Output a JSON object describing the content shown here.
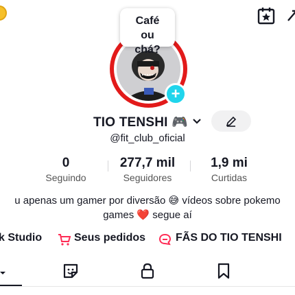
{
  "profile": {
    "bubble_text": "Café ou chá?",
    "username": "TIO TENSHI 🎮",
    "handle": "@fit_club_oficial"
  },
  "stats": [
    {
      "value": "0",
      "label": "Seguindo"
    },
    {
      "value": "277,7 mil",
      "label": "Seguidores"
    },
    {
      "value": "1,9 mi",
      "label": "Curtidas"
    }
  ],
  "bio": {
    "line1": "u apenas um gamer por diversão 😅 vídeos sobre pokemo",
    "line2": "games ❤️ segue aí"
  },
  "links": {
    "studio": "k Studio",
    "orders": "Seus pedidos",
    "fans": "FÃS DO TIO TENSHI"
  },
  "colors": {
    "accent_red": "#fe2c55",
    "avatar_ring": "#e21a1a",
    "add_badge": "#20d5ec"
  },
  "icons": [
    "coin-icon",
    "calendar-star-icon",
    "share-icon",
    "chevron-down-icon",
    "pencil-icon",
    "cart-icon",
    "chat-icon",
    "grid-icon",
    "sticker-icon",
    "lock-icon",
    "bookmark-icon"
  ]
}
